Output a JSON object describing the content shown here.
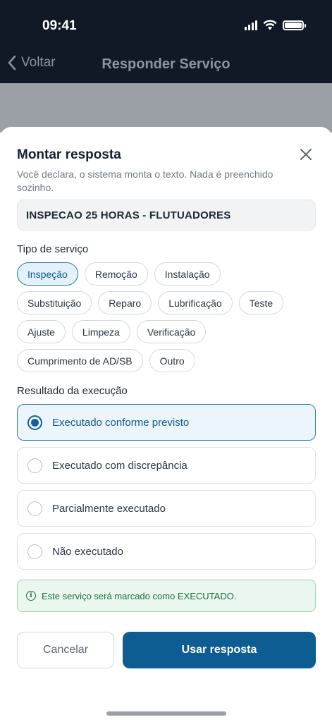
{
  "status_bar": {
    "time": "09:41"
  },
  "nav": {
    "back_label": "Voltar",
    "title": "Responder Serviço"
  },
  "sheet": {
    "title": "Montar resposta",
    "subtitle": "Você declara, o sistema monta o texto. Nada é preenchido sozinho.",
    "service_value": "INSPECAO 25 HORAS - FLUTUADORES",
    "service_type_label": "Tipo de serviço",
    "service_types": [
      [
        "Inspeção",
        "Remoção",
        "Instalação"
      ],
      [
        "Substituição",
        "Reparo",
        "Lubrificação",
        "Teste"
      ],
      [
        "Ajuste",
        "Limpeza",
        "Verificação"
      ],
      [
        "Cumprimento de AD/SB",
        "Outro"
      ]
    ],
    "selected_service_type": "Inspeção",
    "result_label": "Resultado da execução",
    "results": [
      "Executado conforme previsto",
      "Executado com discrepância",
      "Parcialmente executado",
      "Não executado"
    ],
    "selected_result": "Executado conforme previsto",
    "info_message": "Este serviço será marcado como EXECUTADO.",
    "cancel_label": "Cancelar",
    "confirm_label": "Usar resposta"
  },
  "colors": {
    "topbar": "#111926",
    "primary": "#0d5d93",
    "selected_bg": "#ebf5fb",
    "info_bg": "#eaf7ef",
    "info_text": "#1d6b3f"
  },
  "icons": {
    "back": "chevron-left-icon",
    "close": "close-icon",
    "info": "info-icon",
    "signal": "cellular-signal-icon",
    "wifi": "wifi-icon",
    "battery": "battery-icon"
  }
}
